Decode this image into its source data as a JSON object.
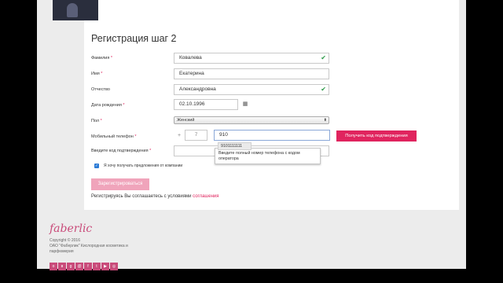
{
  "form": {
    "title": "Регистрация шаг 2",
    "required_mark": "*",
    "fields": [
      {
        "label": "Фамилия",
        "required": true,
        "value": "Ковалева",
        "valid": true
      },
      {
        "label": "Имя",
        "required": true,
        "value": "Екатерина",
        "valid": false
      },
      {
        "label": "Отчество",
        "required": false,
        "value": "Александровна",
        "valid": true
      }
    ],
    "birthdate": {
      "label": "Дата рождения",
      "value": "02.10.1996",
      "icon": "calendar-icon"
    },
    "gender": {
      "label": "Пол",
      "selected": "Женский"
    },
    "phone": {
      "label": "Мобильный телефон",
      "prefix": "+",
      "country_code": "7",
      "value": "910",
      "get_code_label": "Получить код подтверждения"
    },
    "autocomplete": {
      "suggestion": "9101111111",
      "tooltip": "Введите полный номер телефона с кодом оператора"
    },
    "code": {
      "label": "Введите код подтверждения",
      "value": ""
    },
    "offers": {
      "checked": true,
      "label": "Я хочу получать предложения от компании"
    },
    "submit_label": "Зарегистрироваться",
    "agreement": {
      "text": "Регистрируясь Вы соглашаетесь с условиями",
      "link": "соглашения"
    }
  },
  "footer": {
    "logo": "faberlic",
    "copyright": "Copyright © 2016",
    "company": "ОАО \"Фаберлик\" Кислородная косметика и парфюмерия",
    "socials": [
      {
        "icon": "odnoklassniki-icon",
        "glyph": "о"
      },
      {
        "icon": "vk-icon",
        "glyph": "в"
      },
      {
        "icon": "googleplus-icon",
        "glyph": "g"
      },
      {
        "icon": "mailru-icon",
        "glyph": "@"
      },
      {
        "icon": "facebook-icon",
        "glyph": "f"
      },
      {
        "icon": "twitter-icon",
        "glyph": "t"
      },
      {
        "icon": "youtube-icon",
        "glyph": "▶"
      },
      {
        "icon": "instagram-icon",
        "glyph": "◎"
      }
    ]
  },
  "colors": {
    "accent": "#e0245e",
    "accent_light": "#f0a4bb",
    "valid": "#2e9b4a",
    "checkbox": "#2b7bd6",
    "logo": "#c94b7a"
  }
}
